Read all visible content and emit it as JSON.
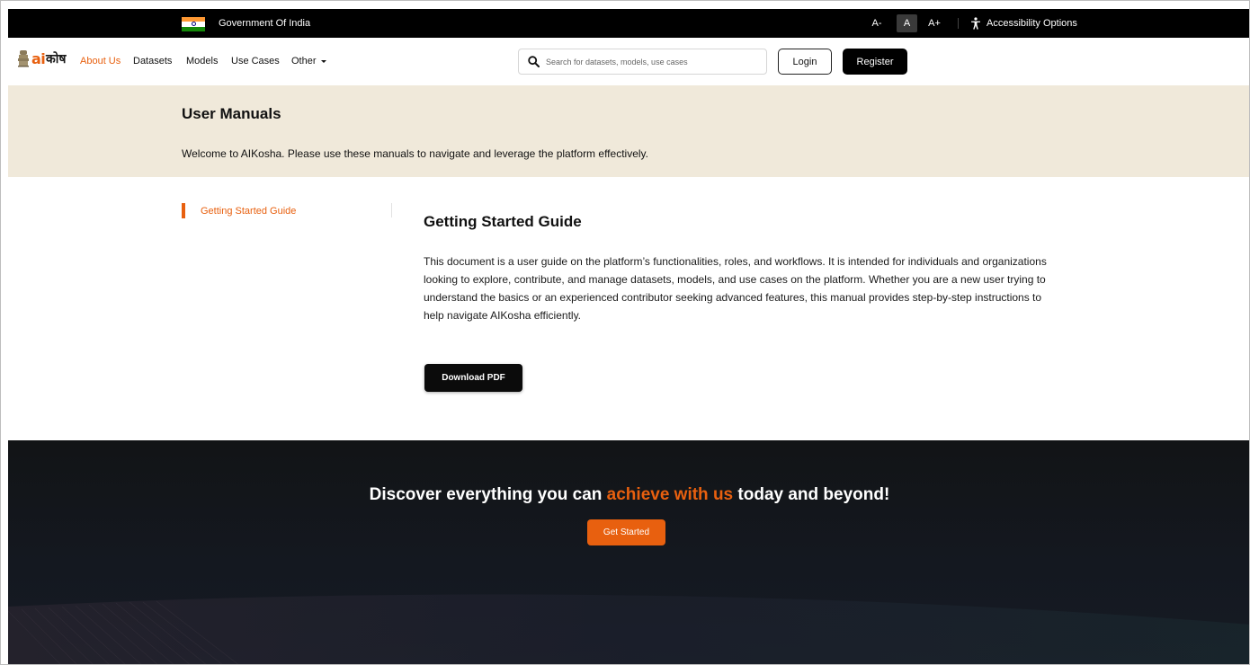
{
  "gov_bar": {
    "label": "Government Of India",
    "font_sizes": [
      "A-",
      "A",
      "A+"
    ],
    "accessibility_label": "Accessibility Options"
  },
  "logo": {
    "ai": "ai",
    "kosh": "कोष"
  },
  "nav": {
    "items": [
      "About Us",
      "Datasets",
      "Models",
      "Use Cases",
      "Other"
    ],
    "active": "About Us"
  },
  "search": {
    "placeholder": "Search for datasets, models, use cases",
    "value": ""
  },
  "auth": {
    "login_label": "Login",
    "register_label": "Register"
  },
  "hero": {
    "title": "User Manuals",
    "subtitle": "Welcome to AIKosha. Please use these manuals to navigate and leverage the platform effectively."
  },
  "sidebar": {
    "items": [
      "Getting Started Guide"
    ]
  },
  "guide": {
    "title": "Getting Started Guide",
    "body": "This document is a user guide on the platform’s functionalities, roles, and workflows. It is intended for individuals and organizations looking to explore, contribute, and manage datasets, models, and use cases on the platform. Whether you are a new user trying to understand the basics or an experienced contributor seeking advanced features, this manual provides step-by-step instructions to help navigate AIKosha efficiently.",
    "download_label": "Download PDF"
  },
  "cta": {
    "heading_before": "Discover everything you can ",
    "heading_highlight": "achieve with us",
    "heading_after": " today and beyond!",
    "button_label": "Get Started"
  },
  "colors": {
    "accent": "#e8600f",
    "gov_bar_bg": "#000000",
    "hero_bg": "#f0e9da",
    "cta_bg": "#141820"
  },
  "icons": {
    "flag": "india-flag-icon",
    "accessibility": "accessibility-icon",
    "search": "search-icon",
    "dropdown": "chevron-down-icon",
    "emblem": "national-emblem-icon"
  }
}
